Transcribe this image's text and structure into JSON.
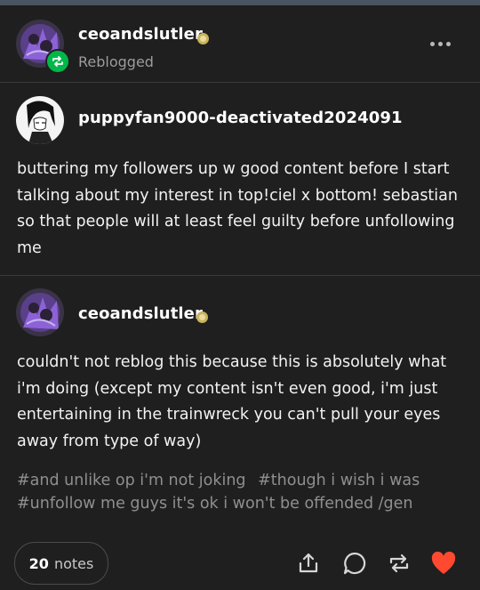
{
  "colors": {
    "background": "#1f1f1f",
    "reblog_badge": "#00b84a",
    "heart": "#ff4930",
    "tags": "#8f8f8f"
  },
  "header": {
    "reblogger": "ceoandslutler",
    "status": "Reblogged",
    "more_icon": "more-dots-icon"
  },
  "original_post": {
    "author": "puppyfan9000-deactivated2024091",
    "text": "buttering my followers up w good content before I start talking about my interest in top!ciel x bottom! sebastian so that people will at least feel guilty before unfollowing me"
  },
  "reblog": {
    "author": "ceoandslutler",
    "text": "couldn't not reblog this because this is absolutely what i'm doing (except my content isn't even good, i'm just entertaining in the trainwreck you can't pull your eyes away from type of way)",
    "tags": [
      "#and unlike op i'm not joking",
      "#though i wish i was",
      "#unfollow me guys it's ok i won't be offended /gen"
    ]
  },
  "footer": {
    "notes_count": "20",
    "notes_label": "notes",
    "actions": [
      "share-icon",
      "reply-icon",
      "reblog-icon",
      "like-heart-icon"
    ]
  }
}
